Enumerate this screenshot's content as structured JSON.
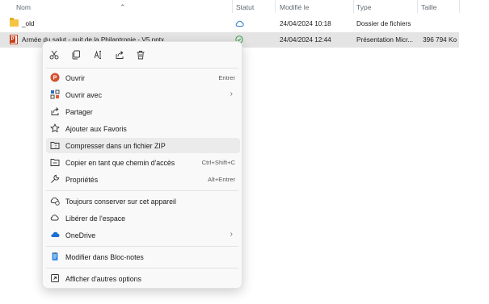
{
  "columns": {
    "name": "Nom",
    "status": "Statut",
    "modified": "Modifié le",
    "type": "Type",
    "size": "Taille"
  },
  "files": [
    {
      "name": "_old",
      "modified": "24/04/2024 10:18",
      "type": "Dossier de fichiers",
      "size": "",
      "icon": "folder-icon",
      "status_icon": "cloud-icon"
    },
    {
      "name": "Armée du salut - nuit de la Philantropie - V5.pptx",
      "modified": "24/04/2024 12:44",
      "type": "Présentation Micr...",
      "size": "396 794 Ko",
      "icon": "powerpoint-file-icon",
      "status_icon": "synced-check-icon"
    }
  ],
  "menu": {
    "toolbar": [
      "cut-icon",
      "copy-icon",
      "rename-icon",
      "share-icon",
      "delete-icon"
    ],
    "items": [
      {
        "label": "Ouvrir",
        "shortcut": "Entrer",
        "icon": "powerpoint-icon"
      },
      {
        "label": "Ouvrir avec",
        "shortcut": "",
        "icon": "open-with-icon",
        "submenu": true
      },
      {
        "label": "Partager",
        "shortcut": "",
        "icon": "share-icon"
      },
      {
        "label": "Ajouter aux Favoris",
        "shortcut": "",
        "icon": "star-icon"
      },
      {
        "label": "Compresser dans un fichier ZIP",
        "shortcut": "",
        "icon": "zip-icon"
      },
      {
        "label": "Copier en tant que chemin d'accès",
        "shortcut": "Ctrl+Shift+C",
        "icon": "copy-path-icon"
      },
      {
        "label": "Propriétés",
        "shortcut": "Alt+Entrer",
        "icon": "wrench-icon"
      },
      {
        "label": "Toujours conserver sur cet appareil",
        "shortcut": "",
        "icon": "cloud-keep-icon"
      },
      {
        "label": "Libérer de l'espace",
        "shortcut": "",
        "icon": "cloud-outline-icon"
      },
      {
        "label": "OneDrive",
        "shortcut": "",
        "icon": "onedrive-icon",
        "submenu": true
      },
      {
        "label": "Modifier dans Bloc-notes",
        "shortcut": "",
        "icon": "notepad-icon"
      },
      {
        "label": "Afficher d'autres options",
        "shortcut": "",
        "icon": "more-options-icon"
      }
    ]
  }
}
